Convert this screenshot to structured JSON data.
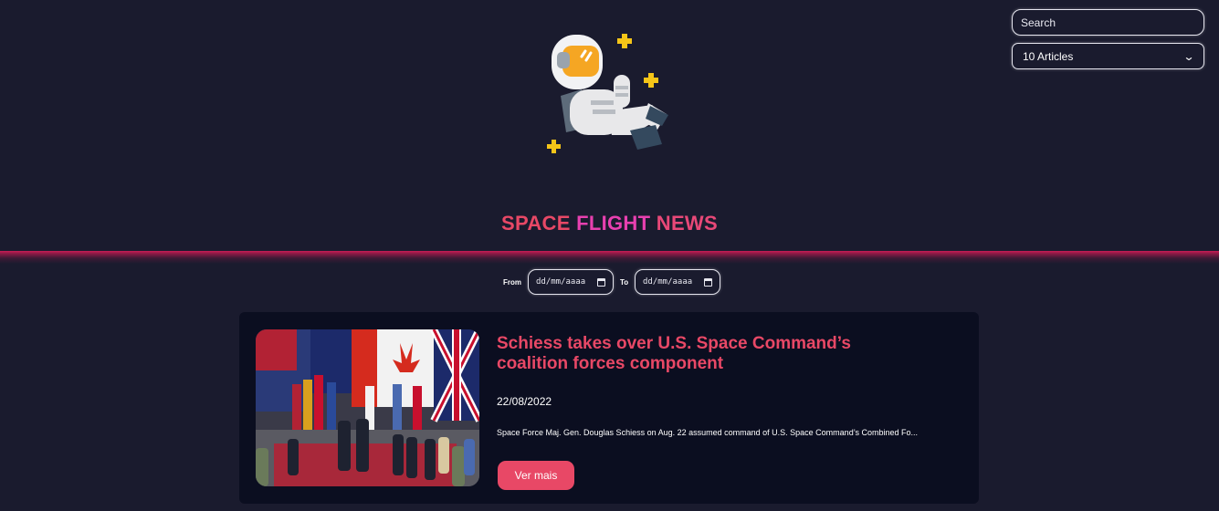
{
  "search": {
    "placeholder": "Search"
  },
  "article_count_select": {
    "selected": "10 Articles"
  },
  "header": {
    "title_words": [
      "SPACE",
      "FLIGHT",
      "NEWS"
    ]
  },
  "filters": {
    "from_label": "From",
    "to_label": "To",
    "from_placeholder": "dd/mm/aaaa",
    "to_placeholder": "dd/mm/aaaa"
  },
  "articles": [
    {
      "title": "Schiess takes over U.S. Space Command’s coalition forces component",
      "date": "22/08/2022",
      "excerpt": "Space Force Maj. Gen. Douglas Schiess on Aug. 22 assumed command of U.S. Space Command’s Combined Fo...",
      "button_label": "Ver mais"
    }
  ],
  "colors": {
    "background": "#1a1b2e",
    "accent": "#e84866",
    "card": "#0b0e20"
  },
  "icons": {
    "logo": "astronaut-icon",
    "calendar": "calendar-icon",
    "select": "chevron-down-icon"
  }
}
